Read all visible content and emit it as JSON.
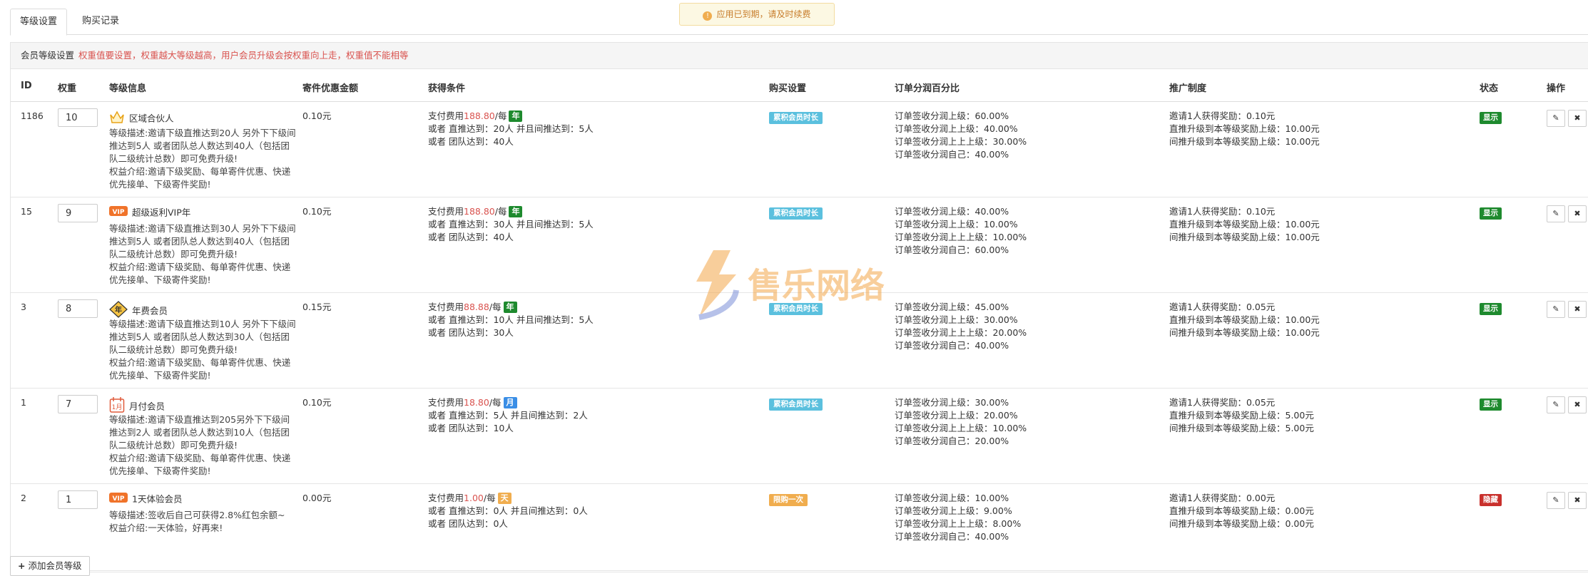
{
  "tabs": [
    {
      "label": "等级设置",
      "active": true
    },
    {
      "label": "购买记录",
      "active": false
    }
  ],
  "notice": "应用已到期，请及时续费",
  "panel": {
    "title": "会员等级设置",
    "hint": "权重值要设置，权重越大等级越高，用户会员升级会按权重向上走，权重值不能相等"
  },
  "columns": [
    "ID",
    "权重",
    "等级信息",
    "寄件优惠金额",
    "获得条件",
    "购买设置",
    "订单分润百分比",
    "推广制度",
    "状态",
    "操作"
  ],
  "rows": [
    {
      "id": "1186",
      "weight": "10",
      "icon": "crown-icon",
      "name": "区域合伙人",
      "desc": [
        "等级描述:邀请下级直推达到20人 另外下下级间推达到5人 或者团队总人数达到40人（包括团队二级统计总数）即可免费升级!",
        "权益介绍:邀请下级奖励、每单寄件优惠、快递优先接单、下级寄件奖励!"
      ],
      "discount": "0.10元",
      "pay_prefix": "支付费用",
      "pay_amount": "188.80",
      "pay_suffix": "/每",
      "period": "年",
      "period_color": "#1e8a2e",
      "cond2": "或者 直推达到：20人 并且间推达到：5人",
      "cond3": "或者 团队达到：40人",
      "purchase": "累积会员时长",
      "purchase_color": "#5bc0de",
      "profit": [
        "订单签收分润上级：60.00%",
        "订单签收分润上上级：40.00%",
        "订单签收分润上上上级：30.00%",
        "订单签收分润自己：40.00%"
      ],
      "promo": [
        "邀请1人获得奖励：0.10元",
        "直推升级到本等级奖励上级：10.00元",
        "间推升级到本等级奖励上级：10.00元"
      ],
      "status": "显示",
      "status_color": "#1e8a2e"
    },
    {
      "id": "15",
      "weight": "9",
      "icon": "vip-icon",
      "name": "超级返利VIP年",
      "desc": [
        "等级描述:邀请下级直推达到30人 另外下下级间推达到5人 或者团队总人数达到40人（包括团队二级统计总数）即可免费升级!",
        "权益介绍:邀请下级奖励、每单寄件优惠、快递优先接单、下级寄件奖励!"
      ],
      "discount": "0.10元",
      "pay_prefix": "支付费用",
      "pay_amount": "188.80",
      "pay_suffix": "/每",
      "period": "年",
      "period_color": "#1e8a2e",
      "cond2": "或者 直推达到：30人 并且间推达到：5人",
      "cond3": "或者 团队达到：40人",
      "purchase": "累积会员时长",
      "purchase_color": "#5bc0de",
      "profit": [
        "订单签收分润上级：40.00%",
        "订单签收分润上上级：10.00%",
        "订单签收分润上上上级：10.00%",
        "订单签收分润自己：60.00%"
      ],
      "promo": [
        "邀请1人获得奖励：0.10元",
        "直推升级到本等级奖励上级：10.00元",
        "间推升级到本等级奖励上级：10.00元"
      ],
      "status": "显示",
      "status_color": "#1e8a2e"
    },
    {
      "id": "3",
      "weight": "8",
      "icon": "year-diamond-icon",
      "name": "年费会员",
      "desc": [
        "等级描述:邀请下级直推达到10人 另外下下级间推达到5人 或者团队总人数达到30人（包括团队二级统计总数）即可免费升级!",
        "权益介绍:邀请下级奖励、每单寄件优惠、快递优先接单、下级寄件奖励!"
      ],
      "discount": "0.15元",
      "pay_prefix": "支付费用",
      "pay_amount": "88.88",
      "pay_suffix": "/每",
      "period": "年",
      "period_color": "#1e8a2e",
      "cond2": "或者 直推达到：10人 并且间推达到：5人",
      "cond3": "或者 团队达到：30人",
      "purchase": "累积会员时长",
      "purchase_color": "#5bc0de",
      "profit": [
        "订单签收分润上级：45.00%",
        "订单签收分润上上级：30.00%",
        "订单签收分润上上上级：20.00%",
        "订单签收分润自己：40.00%"
      ],
      "promo": [
        "邀请1人获得奖励：0.05元",
        "直推升级到本等级奖励上级：10.00元",
        "间推升级到本等级奖励上级：10.00元"
      ],
      "status": "显示",
      "status_color": "#1e8a2e"
    },
    {
      "id": "1",
      "weight": "7",
      "icon": "month-calendar-icon",
      "name": "月付会员",
      "desc": [
        "等级描述:邀请下级直推达到205另外下下级间推达到2人 或者团队总人数达到10人（包括团队二级统计总数）即可免费升级!",
        "权益介绍:邀请下级奖励、每单寄件优惠、快递优先接单、下级寄件奖励!"
      ],
      "discount": "0.10元",
      "pay_prefix": "支付费用",
      "pay_amount": "18.80",
      "pay_suffix": "/每",
      "period": "月",
      "period_color": "#3a8ee6",
      "cond2": "或者 直推达到：5人 并且间推达到：2人",
      "cond3": "或者 团队达到：10人",
      "purchase": "累积会员时长",
      "purchase_color": "#5bc0de",
      "profit": [
        "订单签收分润上级：30.00%",
        "订单签收分润上上级：20.00%",
        "订单签收分润上上上级：10.00%",
        "订单签收分润自己：20.00%"
      ],
      "promo": [
        "邀请1人获得奖励：0.05元",
        "直推升级到本等级奖励上级：5.00元",
        "间推升级到本等级奖励上级：5.00元"
      ],
      "status": "显示",
      "status_color": "#1e8a2e"
    },
    {
      "id": "2",
      "weight": "1",
      "icon": "vip-icon",
      "name": "1天体验会员",
      "desc": [
        "等级描述:签收后自己可获得2.8%红包余额~",
        "权益介绍:一天体验，好再来!"
      ],
      "discount": "0.00元",
      "pay_prefix": "支付费用",
      "pay_amount": "1.00",
      "pay_suffix": "/每",
      "period": "天",
      "period_color": "#f0ad4e",
      "cond2": "或者 直推达到：0人 并且间推达到：0人",
      "cond3": "或者 团队达到：0人",
      "purchase": "限购一次",
      "purchase_color": "#f0ad4e",
      "profit": [
        "订单签收分润上级：10.00%",
        "订单签收分润上上级：9.00%",
        "订单签收分润上上上级：8.00%",
        "订单签收分润自己：40.00%"
      ],
      "promo": [
        "邀请1人获得奖励：0.00元",
        "直推升级到本等级奖励上级：0.00元",
        "间推升级到本等级奖励上级：0.00元"
      ],
      "status": "隐藏",
      "status_color": "#c9302c"
    }
  ],
  "actions": {
    "edit_icon": "edit-icon",
    "delete_icon": "close-icon"
  },
  "add_button": "添加会员等级",
  "watermark": "售乐网络"
}
